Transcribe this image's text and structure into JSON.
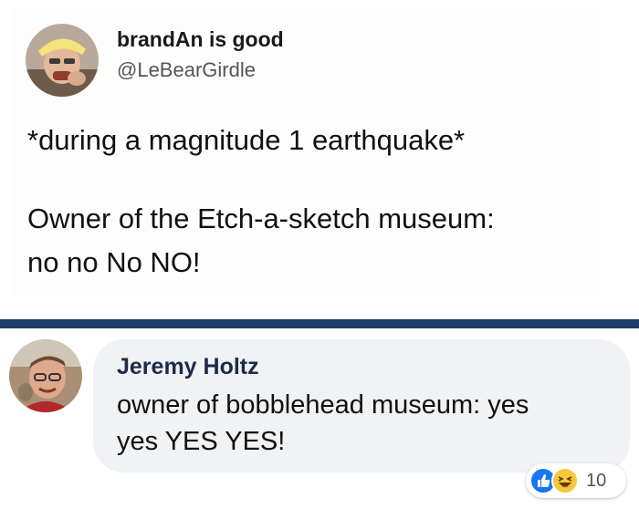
{
  "tweet": {
    "display_name": "brandAn is good",
    "handle": "@LeBearGirdle",
    "lines": [
      "*during a magnitude 1 earthquake*",
      "Owner of the Etch-a-sketch museum:",
      "no no No NO!"
    ],
    "avatar_icon": "user-avatar-photo"
  },
  "colors": {
    "divider": "#1f3c6b",
    "bubble_bg": "#f1f2f4",
    "commenter_name": "#1c2b48",
    "like_blue": "#1877f2",
    "haha_yellow": "#f7c93a"
  },
  "comment": {
    "author": "Jeremy Holtz",
    "text_line1": "owner of bobblehead museum: yes",
    "text_line2": "yes YES YES!",
    "avatar_icon": "user-avatar-photo",
    "reactions": {
      "icons": [
        "like-icon",
        "haha-icon"
      ],
      "count": "10"
    }
  }
}
